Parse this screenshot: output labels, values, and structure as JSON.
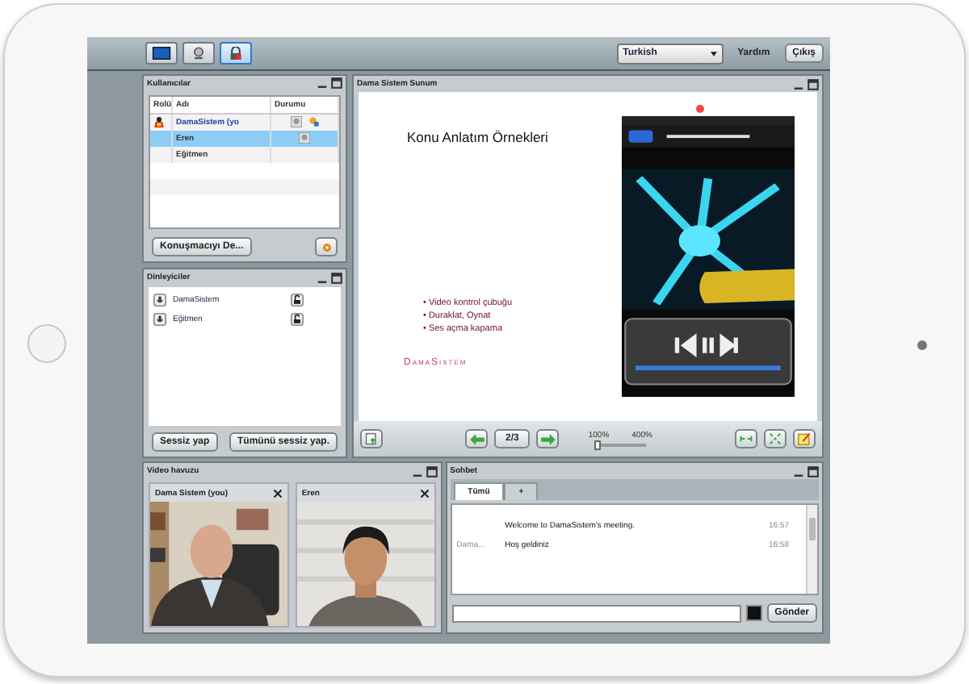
{
  "toolbar": {
    "tools": [
      {
        "kind": "screen",
        "selected": false
      },
      {
        "kind": "webcam",
        "selected": false
      },
      {
        "kind": "lock",
        "selected": true
      }
    ],
    "language": "Turkish",
    "links": [
      "Yardım"
    ],
    "exit": "Çıkış"
  },
  "users": {
    "title": "Kullanıcılar",
    "columns": [
      "Rolü",
      "Adı",
      "Durumu"
    ],
    "rows": [
      {
        "name": "DamaSistem (yo",
        "presenter": true,
        "self": true,
        "selected": false,
        "webcam": true,
        "raised_hand": true
      },
      {
        "name": "Eren",
        "presenter": false,
        "self": false,
        "selected": true,
        "webcam": true,
        "raised_hand": false
      },
      {
        "name": "Eğitmen",
        "presenter": false,
        "self": false,
        "selected": false,
        "webcam": false,
        "raised_hand": false
      }
    ],
    "button": "Konuşmacıyı De..."
  },
  "listeners": {
    "title": "Dinleyiciler",
    "items": [
      {
        "name": "DamaSistem",
        "locked": false
      },
      {
        "name": "Eğitmen",
        "locked": false
      }
    ],
    "buttons": [
      "Sessiz yap",
      "Tümünü sessiz yap."
    ]
  },
  "presentation": {
    "title": "Dama Sistem Sunum",
    "slide": {
      "heading": "Konu Anlatım Örnekleri",
      "bullet_mark": "•",
      "bullets": [
        "Video kontrol çubuğu",
        "Duraklat, Oynat",
        "Ses açma kapama"
      ],
      "logo": "DamaSistem"
    },
    "page": "2/3",
    "zoom_min": "100%",
    "zoom_max": "400%",
    "zoom": {
      "level": 0.05
    }
  },
  "video": {
    "title": "Video havuzu",
    "tiles": [
      {
        "name": "Dama Sistem (you)",
        "kind": "picture"
      },
      {
        "name": "Eren",
        "kind": "picture"
      }
    ]
  },
  "chat": {
    "title": "Sohbet",
    "tabs": [
      {
        "label": "Tümü",
        "selected": true
      },
      {
        "label": "+",
        "selected": false
      }
    ],
    "messages": [
      {
        "text": "Welcome to DamaSistem's meeting.",
        "time": "16:57"
      },
      {
        "sender": "Dama...",
        "text": "Hoş geldiniz",
        "time": "16:58"
      }
    ],
    "send": "Gönder"
  }
}
